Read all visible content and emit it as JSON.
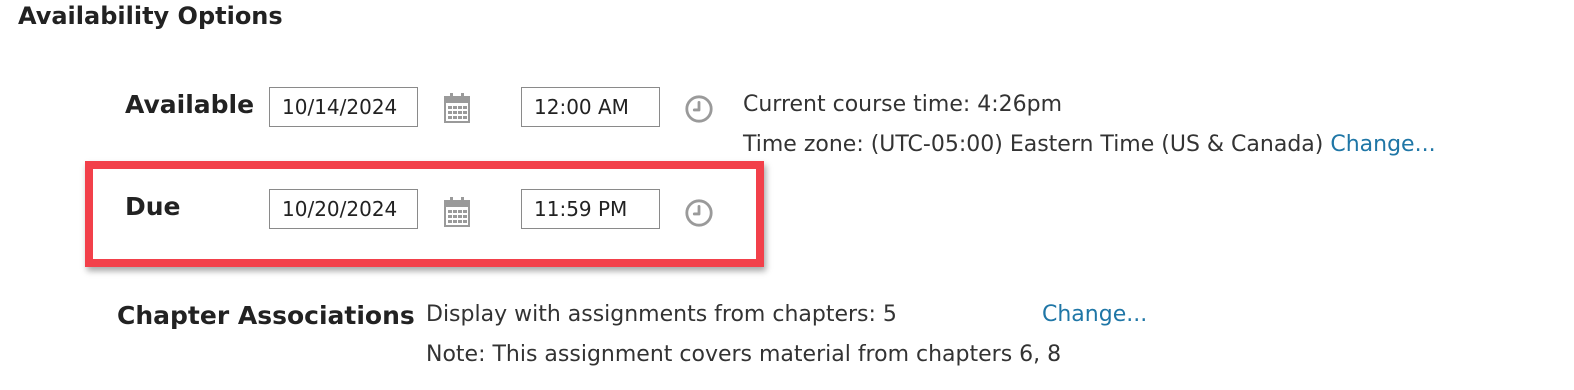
{
  "section_title": "Availability Options",
  "available": {
    "label": "Available",
    "date": "10/14/2024",
    "time": "12:00 AM"
  },
  "due": {
    "label": "Due",
    "date": "10/20/2024",
    "time": "11:59 PM"
  },
  "course_time": {
    "text": "Current course time: 4:26pm",
    "timezone_text": "Time zone: (UTC-05:00) Eastern Time (US & Canada)",
    "change_link": "Change..."
  },
  "chapter_associations": {
    "label": "Chapter Associations",
    "display_text": "Display with assignments from chapters:  5",
    "change_link": "Change...",
    "note": "Note: This assignment covers material from chapters 6, 8"
  },
  "icons": {
    "calendar": "calendar-icon",
    "clock": "clock-icon"
  },
  "colors": {
    "link": "#1f76a6",
    "highlight": "#f2404a",
    "icon": "#9a9a9a"
  }
}
